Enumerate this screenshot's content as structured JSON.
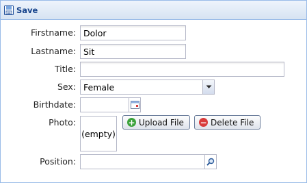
{
  "toolbar": {
    "save_label": "Save"
  },
  "form": {
    "firstname": {
      "label": "Firstname:",
      "value": "Dolor"
    },
    "lastname": {
      "label": "Lastname:",
      "value": "Sit"
    },
    "title": {
      "label": "Title:",
      "value": ""
    },
    "sex": {
      "label": "Sex:",
      "value": "Female"
    },
    "birthdate": {
      "label": "Birthdate:",
      "value": ""
    },
    "photo": {
      "label": "Photo:",
      "placeholder": "(empty)",
      "upload_label": "Upload File",
      "delete_label": "Delete File"
    },
    "position": {
      "label": "Position:",
      "value": ""
    }
  },
  "colors": {
    "toolbar_text": "#15428b",
    "border": "#99bbe8",
    "upload_icon": "#3aa23a",
    "delete_icon": "#d83b3b"
  },
  "icons": [
    "save-icon",
    "chevron-down-icon",
    "calendar-icon",
    "plus-icon",
    "minus-icon",
    "search-icon"
  ]
}
